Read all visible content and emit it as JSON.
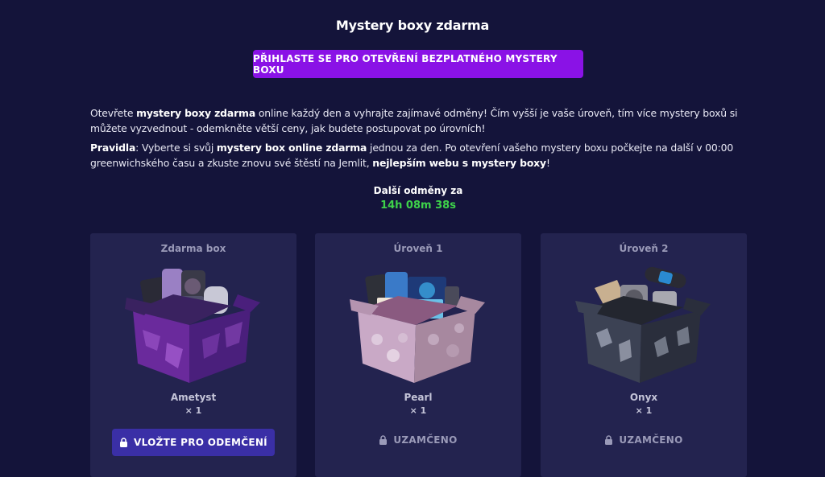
{
  "header": {
    "title": "Mystery boxy zdarma",
    "login_button": "PŘIHLASTE SE PRO OTEVŘENÍ BEZPLATNÉHO MYSTERY BOXU"
  },
  "description": {
    "p1": [
      {
        "text": "Otevřete ",
        "bold": false
      },
      {
        "text": "mystery boxy zdarma",
        "bold": true
      },
      {
        "text": " online každý den a vyhrajte zajímavé odměny! Čím vyšší je vaše úroveň, tím více mystery boxů si můžete vyzvednout - odemkněte větší ceny, jak budete postupovat po úrovních!",
        "bold": false
      }
    ],
    "p2": [
      {
        "text": "Pravidla",
        "bold": true
      },
      {
        "text": ": Vyberte si svůj ",
        "bold": false
      },
      {
        "text": "mystery box online zdarma",
        "bold": true
      },
      {
        "text": " jednou za den. Po otevření vašeho mystery boxu počkejte na další v 00:00 greenwichského času a zkuste znovu své štěstí na Jemlit, ",
        "bold": false
      },
      {
        "text": "nejlepším webu s mystery boxy",
        "bold": true
      },
      {
        "text": "!",
        "bold": false
      }
    ]
  },
  "countdown": {
    "label": "Další odměny za",
    "time": "14h 08m 38s",
    "color": "#3ed24a"
  },
  "cards": [
    {
      "level": "Zdarma box",
      "name": "Ametyst",
      "qty": "× 1",
      "action": "VLOŽTE PRO ODEMČENÍ",
      "locked": false,
      "icon": "lock-icon",
      "box_color": "#6a2a9c"
    },
    {
      "level": "Úroveň 1",
      "name": "Pearl",
      "qty": "× 1",
      "action": "UZAMČENO",
      "locked": true,
      "icon": "lock-icon",
      "box_color": "#c9a9c6"
    },
    {
      "level": "Úroveň 2",
      "name": "Onyx",
      "qty": "× 1",
      "action": "UZAMČENO",
      "locked": true,
      "icon": "lock-icon",
      "box_color": "#3c4254"
    }
  ],
  "colors": {
    "background": "#14143a",
    "card": "#23234f",
    "login_button": "#8a12e6",
    "deposit_button": "#3a2fa6"
  }
}
